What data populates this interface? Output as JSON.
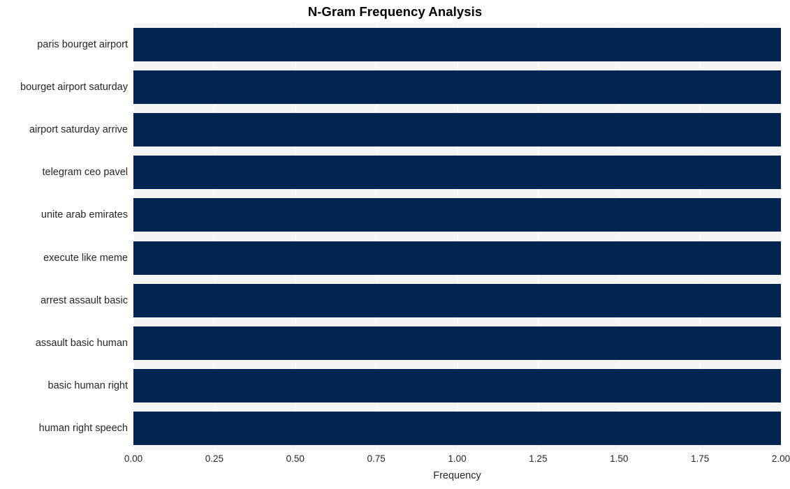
{
  "chart_data": {
    "type": "bar",
    "orientation": "horizontal",
    "title": "N-Gram Frequency Analysis",
    "xlabel": "Frequency",
    "ylabel": "",
    "categories": [
      "paris bourget airport",
      "bourget airport saturday",
      "airport saturday arrive",
      "telegram ceo pavel",
      "unite arab emirates",
      "execute like meme",
      "arrest assault basic",
      "assault basic human",
      "basic human right",
      "human right speech"
    ],
    "values": [
      2,
      2,
      2,
      2,
      2,
      2,
      2,
      2,
      2,
      2
    ],
    "xlim": [
      0.0,
      2.0
    ],
    "xticks": [
      0.0,
      0.25,
      0.5,
      0.75,
      1.0,
      1.25,
      1.5,
      1.75,
      2.0
    ],
    "xtick_labels": [
      "0.00",
      "0.25",
      "0.50",
      "0.75",
      "1.00",
      "1.25",
      "1.50",
      "1.75",
      "2.00"
    ],
    "grid": true,
    "grid_axis": "x",
    "legend": null,
    "colors": {
      "bar": "#022450",
      "plot_background": "#f5f5f5",
      "figure_background": "#ffffff",
      "gridline": "#ffffff",
      "text": "#262626",
      "title": "#000000"
    }
  }
}
